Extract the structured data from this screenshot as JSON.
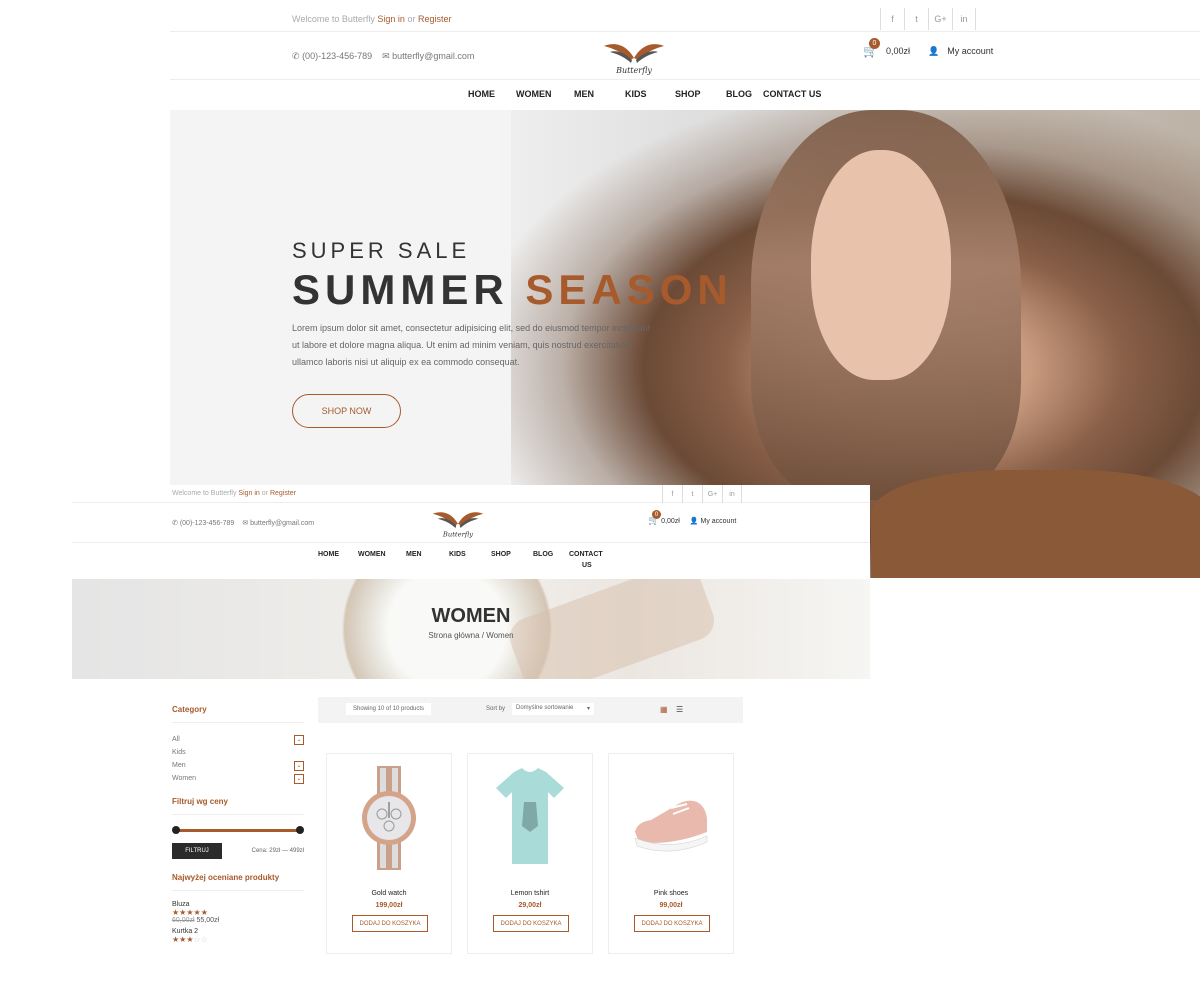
{
  "top": {
    "welcome": "Welcome to Butterfly",
    "sign_in": "Sign in",
    "or": "or",
    "register": "Register",
    "social": [
      "f",
      "t",
      "G+",
      "in"
    ],
    "phone": "(00)-123-456-789",
    "email": "butterfly@gmail.com",
    "logo_text": "Butterfly",
    "cart_count": "0",
    "cart_total": "0,00zł",
    "account": "My account",
    "nav": [
      "HOME",
      "WOMEN",
      "MEN",
      "KIDS",
      "SHOP",
      "BLOG",
      "CONTACT US"
    ]
  },
  "hero": {
    "subtitle": "SUPER SALE",
    "title_main": "SUMMER",
    "title_accent": "SEASON",
    "text": "Lorem ipsum dolor sit amet, consectetur adipisicing elit, sed do eiusmod tempor incididunt ut labore et dolore magna aliqua. Ut enim ad minim veniam, quis nostrud exercitation ullamco laboris nisi ut aliquip ex ea commodo consequat.",
    "button": "SHOP NOW"
  },
  "shop": {
    "welcome": "Welcome to Butterfly",
    "sign_in": "Sign in",
    "or": "or",
    "register": "Register",
    "social": [
      "f",
      "t",
      "G+",
      "in"
    ],
    "phone": "(00)-123-456-789",
    "email": "butterfly@gmail.com",
    "logo_text": "Butterfly",
    "cart_count": "0",
    "cart_total": "0,00zł",
    "account": "My account",
    "nav": [
      "HOME",
      "WOMEN",
      "MEN",
      "KIDS",
      "SHOP",
      "BLOG",
      "CONTACT",
      "US"
    ],
    "banner_title": "WOMEN",
    "breadcrumb": "Strona główna / Women",
    "sidebar": {
      "category_title": "Category",
      "categories": [
        "All",
        "Kids",
        "Men",
        "Women"
      ],
      "filter_title": "Filtruj wg ceny",
      "filter_button": "FILTRUJ",
      "price_range": "Cena: 29zł — 499zł",
      "top_rated_title": "Najwyżej oceniane produkty",
      "top_rated": [
        {
          "name": "Bluza",
          "rating": 5,
          "old_price": "60,00zł",
          "price": "55,00zł"
        },
        {
          "name": "Kurtka 2",
          "rating": 3
        }
      ]
    },
    "toolbar": {
      "showing": "Showing 10 of 10 products",
      "sort_label": "Sort by",
      "sort_value": "Domyślne sortowanie"
    },
    "products": [
      {
        "name": "Gold watch",
        "price": "199,00zł",
        "button": "DODAJ DO KOSZYKA"
      },
      {
        "name": "Lemon tshirt",
        "price": "29,00zł",
        "button": "DODAJ DO KOSZYKA"
      },
      {
        "name": "Pink shoes",
        "price": "99,00zł",
        "button": "DODAJ DO KOSZYKA"
      }
    ],
    "colors": {
      "accent": "#a75a2c",
      "dark": "#2b2b2b"
    }
  }
}
